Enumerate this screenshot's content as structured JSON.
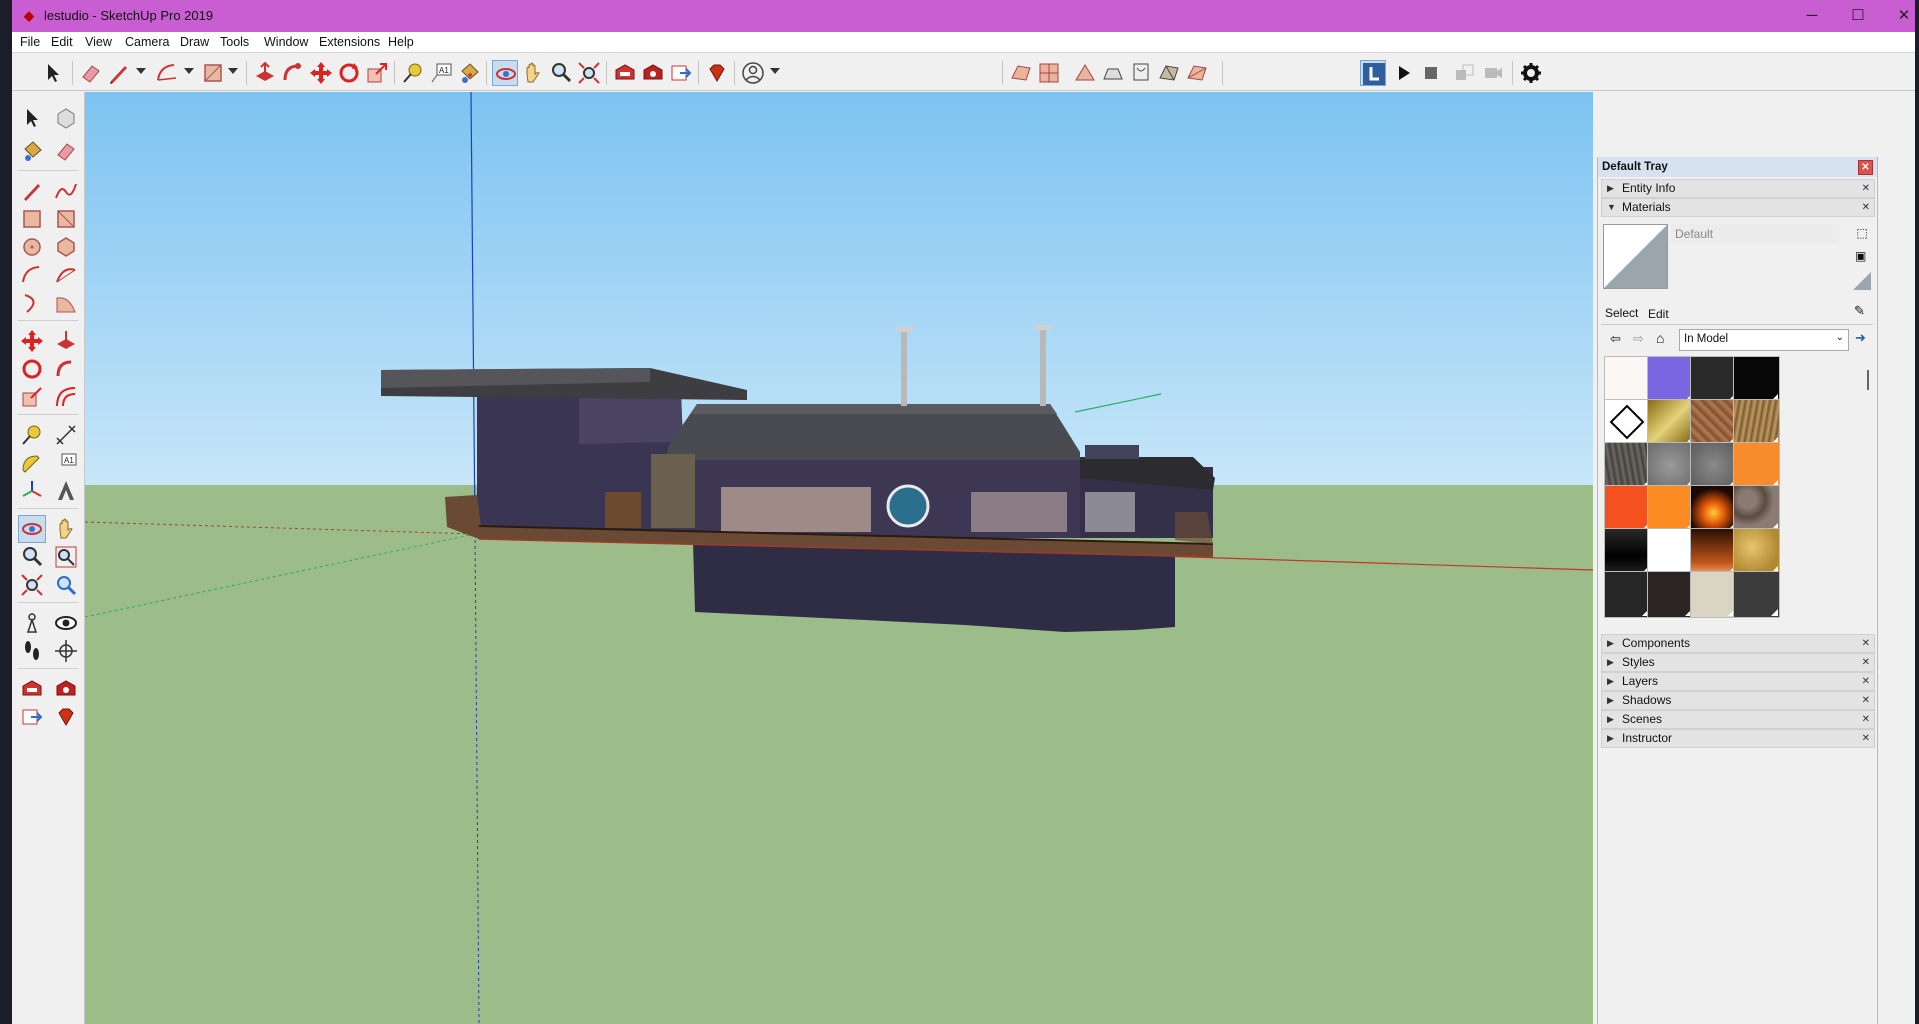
{
  "window": {
    "title": "lestudio - SketchUp Pro 2019",
    "app_icon": "sketchup-logo-icon",
    "controls": {
      "minimize": "─",
      "maximize": "☐",
      "close": "✕"
    }
  },
  "menu": {
    "items": [
      "File",
      "Edit",
      "View",
      "Camera",
      "Draw",
      "Tools",
      "Window",
      "Extensions",
      "Help"
    ]
  },
  "toolbar": {
    "icons": [
      "select-icon",
      "eraser-icon",
      "pencil-icon",
      "arc-icon",
      "rectangle-icon",
      "push-pull-icon",
      "follow-me-icon",
      "move-icon",
      "rotate-icon",
      "scale-icon",
      "tape-measure-icon",
      "text-icon",
      "paint-bucket-icon",
      "orbit-icon",
      "pan-icon",
      "zoom-icon",
      "zoom-extents-icon",
      "warehouse-icon",
      "extension-warehouse-icon",
      "send-to-layout-icon",
      "ruby-icon",
      "account-icon",
      "sandbox-icons",
      "play-icon",
      "stop-icon",
      "settings-gear-icon"
    ],
    "active": "orbit-icon"
  },
  "palette": {
    "active": "orbit-icon"
  },
  "colors": {
    "titlebar": "#c95ed2",
    "sky": "#8ec9f0",
    "ground": "#9cbc8a",
    "axis_red": "#c0392b",
    "axis_green": "#27ae60",
    "axis_blue": "#1f3fbf"
  },
  "tray": {
    "title": "Default Tray",
    "sections_top": [
      {
        "label": "Entity Info",
        "expanded": false
      },
      {
        "label": "Materials",
        "expanded": true
      }
    ],
    "materials": {
      "current_name": "Default",
      "tabs": [
        "Select",
        "Edit"
      ],
      "collection": "In Model",
      "swatch_colors": [
        "#fbf7f5",
        "#7a66e0",
        "#2a2a2a",
        "#070707",
        "#ffffff",
        "#b59a2a",
        "#9c6b46",
        "#a88052",
        "#5d5a57",
        "#858685",
        "#7b7b7b",
        "#f88b2c",
        "#f4511e",
        "#fb8c23",
        "#3a1408",
        "#776a60",
        "#151515",
        "#ffffff",
        "#6c2a0c",
        "#c9a24a",
        "#262626",
        "#2a2522",
        "#d9d5c2",
        "#3c3c3c"
      ]
    },
    "sections_bottom": [
      "Components",
      "Styles",
      "Layers",
      "Shadows",
      "Scenes",
      "Instructor"
    ]
  }
}
